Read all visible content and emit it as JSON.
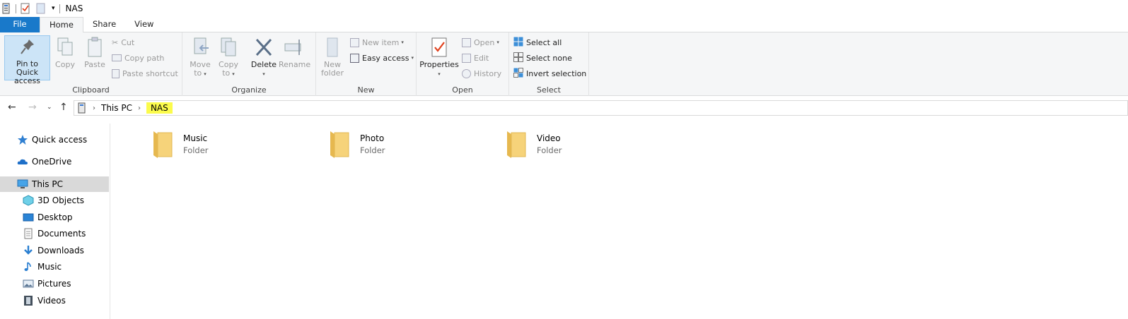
{
  "window": {
    "title": "NAS"
  },
  "tabs": [
    {
      "label": "File"
    },
    {
      "label": "Home"
    },
    {
      "label": "Share"
    },
    {
      "label": "View"
    }
  ],
  "ribbon": {
    "clipboard": {
      "label": "Clipboard",
      "pin": "Pin to Quick",
      "pin2": "access",
      "copy": "Copy",
      "paste": "Paste",
      "cut": "Cut",
      "copy_path": "Copy path",
      "paste_shortcut": "Paste shortcut"
    },
    "organize": {
      "label": "Organize",
      "move": "Move",
      "move2": "to",
      "copy": "Copy",
      "copy2": "to",
      "delete": "Delete",
      "rename": "Rename"
    },
    "new": {
      "label": "New",
      "new_folder": "New",
      "new_folder2": "folder",
      "new_item": "New item",
      "easy_access": "Easy access"
    },
    "open": {
      "label": "Open",
      "properties": "Properties",
      "open": "Open",
      "edit": "Edit",
      "history": "History"
    },
    "select": {
      "label": "Select",
      "select_all": "Select all",
      "select_none": "Select none",
      "invert": "Invert selection"
    }
  },
  "address": {
    "crumbs": [
      "This PC",
      "NAS"
    ]
  },
  "navpane": {
    "items": [
      {
        "label": "Quick access"
      },
      {
        "label": "OneDrive"
      },
      {
        "label": "This PC"
      },
      {
        "label": "3D Objects"
      },
      {
        "label": "Desktop"
      },
      {
        "label": "Documents"
      },
      {
        "label": "Downloads"
      },
      {
        "label": "Music"
      },
      {
        "label": "Pictures"
      },
      {
        "label": "Videos"
      }
    ]
  },
  "content": {
    "items": [
      {
        "name": "Music",
        "type": "Folder"
      },
      {
        "name": "Photo",
        "type": "Folder"
      },
      {
        "name": "Video",
        "type": "Folder"
      }
    ]
  },
  "colors": {
    "file_tab": "#1979ca",
    "highlight": "#fbfb4c",
    "selected_nav": "#d9d9d9",
    "folder": "#f6d37a"
  }
}
